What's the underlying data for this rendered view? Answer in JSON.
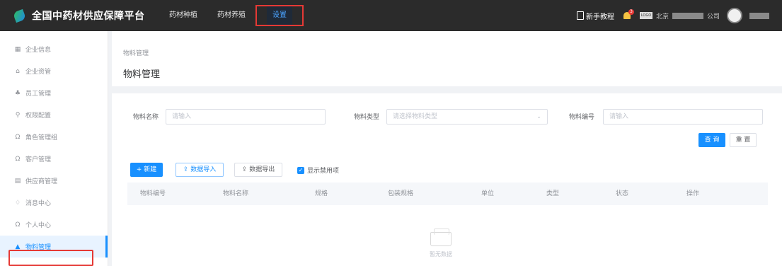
{
  "header": {
    "app_title": "全国中药材供应保障平台",
    "nav": [
      {
        "label": "药材种植"
      },
      {
        "label": "药材养殖"
      },
      {
        "label": "设置"
      }
    ],
    "help_label": "新手教程",
    "notification_count": "3",
    "company_logo_text": "LOGO",
    "company_prefix": "北京",
    "company_suffix": "公司"
  },
  "sidebar": {
    "items": [
      {
        "label": "企业信息",
        "icon": "grid-icon"
      },
      {
        "label": "企业资管",
        "icon": "building-icon"
      },
      {
        "label": "员工管理",
        "icon": "people-icon"
      },
      {
        "label": "权限配置",
        "icon": "key-icon"
      },
      {
        "label": "角色管理组",
        "icon": "role-icon"
      },
      {
        "label": "客户管理",
        "icon": "customer-icon"
      },
      {
        "label": "供应商管理",
        "icon": "document-icon"
      },
      {
        "label": "消息中心",
        "icon": "bell-icon"
      },
      {
        "label": "个人中心",
        "icon": "user-icon"
      },
      {
        "label": "物料管理",
        "icon": "material-icon"
      }
    ]
  },
  "page": {
    "breadcrumb": "物料管理",
    "title": "物料管理"
  },
  "filters": {
    "name_label": "物料名称",
    "name_placeholder": "请输入",
    "type_label": "物料类型",
    "type_placeholder": "请选择物料类型",
    "code_label": "物料编号",
    "code_placeholder": "请输入",
    "search_label": "查 询",
    "reset_label": "重 置"
  },
  "toolbar": {
    "add_label": "+ 新建",
    "import_label": "数据导入",
    "export_label": "数据导出",
    "show_disabled_label": "显示禁用项"
  },
  "table": {
    "columns": [
      "物料编号",
      "物料名称",
      "规格",
      "包装规格",
      "单位",
      "类型",
      "状态",
      "操作"
    ],
    "empty_text": "暂无数据"
  },
  "colors": {
    "primary": "#1890ff",
    "header_bg": "#2b2b2b",
    "highlight": "#e53935"
  }
}
